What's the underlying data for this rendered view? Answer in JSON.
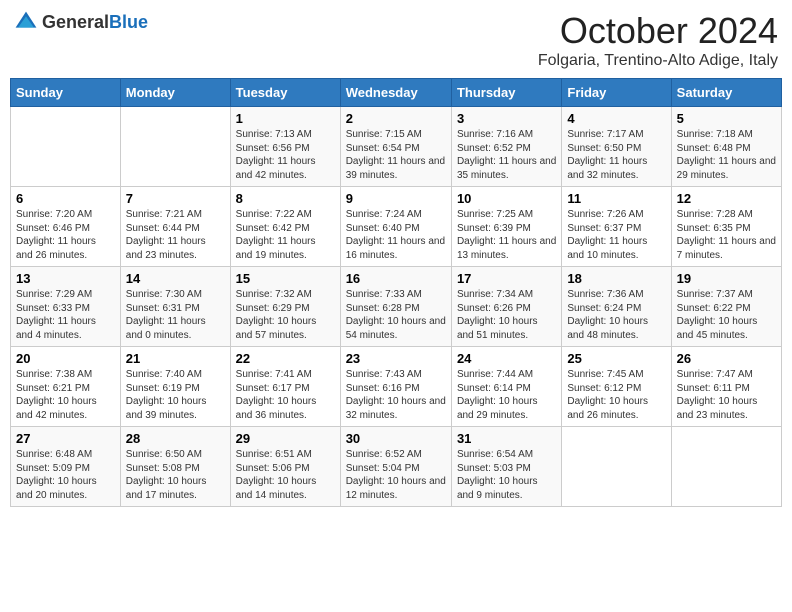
{
  "header": {
    "logo_general": "General",
    "logo_blue": "Blue",
    "month_title": "October 2024",
    "location": "Folgaria, Trentino-Alto Adige, Italy"
  },
  "days_of_week": [
    "Sunday",
    "Monday",
    "Tuesday",
    "Wednesday",
    "Thursday",
    "Friday",
    "Saturday"
  ],
  "weeks": [
    [
      {
        "day": "",
        "sunrise": "",
        "sunset": "",
        "daylight": ""
      },
      {
        "day": "",
        "sunrise": "",
        "sunset": "",
        "daylight": ""
      },
      {
        "day": "1",
        "sunrise": "Sunrise: 7:13 AM",
        "sunset": "Sunset: 6:56 PM",
        "daylight": "Daylight: 11 hours and 42 minutes."
      },
      {
        "day": "2",
        "sunrise": "Sunrise: 7:15 AM",
        "sunset": "Sunset: 6:54 PM",
        "daylight": "Daylight: 11 hours and 39 minutes."
      },
      {
        "day": "3",
        "sunrise": "Sunrise: 7:16 AM",
        "sunset": "Sunset: 6:52 PM",
        "daylight": "Daylight: 11 hours and 35 minutes."
      },
      {
        "day": "4",
        "sunrise": "Sunrise: 7:17 AM",
        "sunset": "Sunset: 6:50 PM",
        "daylight": "Daylight: 11 hours and 32 minutes."
      },
      {
        "day": "5",
        "sunrise": "Sunrise: 7:18 AM",
        "sunset": "Sunset: 6:48 PM",
        "daylight": "Daylight: 11 hours and 29 minutes."
      }
    ],
    [
      {
        "day": "6",
        "sunrise": "Sunrise: 7:20 AM",
        "sunset": "Sunset: 6:46 PM",
        "daylight": "Daylight: 11 hours and 26 minutes."
      },
      {
        "day": "7",
        "sunrise": "Sunrise: 7:21 AM",
        "sunset": "Sunset: 6:44 PM",
        "daylight": "Daylight: 11 hours and 23 minutes."
      },
      {
        "day": "8",
        "sunrise": "Sunrise: 7:22 AM",
        "sunset": "Sunset: 6:42 PM",
        "daylight": "Daylight: 11 hours and 19 minutes."
      },
      {
        "day": "9",
        "sunrise": "Sunrise: 7:24 AM",
        "sunset": "Sunset: 6:40 PM",
        "daylight": "Daylight: 11 hours and 16 minutes."
      },
      {
        "day": "10",
        "sunrise": "Sunrise: 7:25 AM",
        "sunset": "Sunset: 6:39 PM",
        "daylight": "Daylight: 11 hours and 13 minutes."
      },
      {
        "day": "11",
        "sunrise": "Sunrise: 7:26 AM",
        "sunset": "Sunset: 6:37 PM",
        "daylight": "Daylight: 11 hours and 10 minutes."
      },
      {
        "day": "12",
        "sunrise": "Sunrise: 7:28 AM",
        "sunset": "Sunset: 6:35 PM",
        "daylight": "Daylight: 11 hours and 7 minutes."
      }
    ],
    [
      {
        "day": "13",
        "sunrise": "Sunrise: 7:29 AM",
        "sunset": "Sunset: 6:33 PM",
        "daylight": "Daylight: 11 hours and 4 minutes."
      },
      {
        "day": "14",
        "sunrise": "Sunrise: 7:30 AM",
        "sunset": "Sunset: 6:31 PM",
        "daylight": "Daylight: 11 hours and 0 minutes."
      },
      {
        "day": "15",
        "sunrise": "Sunrise: 7:32 AM",
        "sunset": "Sunset: 6:29 PM",
        "daylight": "Daylight: 10 hours and 57 minutes."
      },
      {
        "day": "16",
        "sunrise": "Sunrise: 7:33 AM",
        "sunset": "Sunset: 6:28 PM",
        "daylight": "Daylight: 10 hours and 54 minutes."
      },
      {
        "day": "17",
        "sunrise": "Sunrise: 7:34 AM",
        "sunset": "Sunset: 6:26 PM",
        "daylight": "Daylight: 10 hours and 51 minutes."
      },
      {
        "day": "18",
        "sunrise": "Sunrise: 7:36 AM",
        "sunset": "Sunset: 6:24 PM",
        "daylight": "Daylight: 10 hours and 48 minutes."
      },
      {
        "day": "19",
        "sunrise": "Sunrise: 7:37 AM",
        "sunset": "Sunset: 6:22 PM",
        "daylight": "Daylight: 10 hours and 45 minutes."
      }
    ],
    [
      {
        "day": "20",
        "sunrise": "Sunrise: 7:38 AM",
        "sunset": "Sunset: 6:21 PM",
        "daylight": "Daylight: 10 hours and 42 minutes."
      },
      {
        "day": "21",
        "sunrise": "Sunrise: 7:40 AM",
        "sunset": "Sunset: 6:19 PM",
        "daylight": "Daylight: 10 hours and 39 minutes."
      },
      {
        "day": "22",
        "sunrise": "Sunrise: 7:41 AM",
        "sunset": "Sunset: 6:17 PM",
        "daylight": "Daylight: 10 hours and 36 minutes."
      },
      {
        "day": "23",
        "sunrise": "Sunrise: 7:43 AM",
        "sunset": "Sunset: 6:16 PM",
        "daylight": "Daylight: 10 hours and 32 minutes."
      },
      {
        "day": "24",
        "sunrise": "Sunrise: 7:44 AM",
        "sunset": "Sunset: 6:14 PM",
        "daylight": "Daylight: 10 hours and 29 minutes."
      },
      {
        "day": "25",
        "sunrise": "Sunrise: 7:45 AM",
        "sunset": "Sunset: 6:12 PM",
        "daylight": "Daylight: 10 hours and 26 minutes."
      },
      {
        "day": "26",
        "sunrise": "Sunrise: 7:47 AM",
        "sunset": "Sunset: 6:11 PM",
        "daylight": "Daylight: 10 hours and 23 minutes."
      }
    ],
    [
      {
        "day": "27",
        "sunrise": "Sunrise: 6:48 AM",
        "sunset": "Sunset: 5:09 PM",
        "daylight": "Daylight: 10 hours and 20 minutes."
      },
      {
        "day": "28",
        "sunrise": "Sunrise: 6:50 AM",
        "sunset": "Sunset: 5:08 PM",
        "daylight": "Daylight: 10 hours and 17 minutes."
      },
      {
        "day": "29",
        "sunrise": "Sunrise: 6:51 AM",
        "sunset": "Sunset: 5:06 PM",
        "daylight": "Daylight: 10 hours and 14 minutes."
      },
      {
        "day": "30",
        "sunrise": "Sunrise: 6:52 AM",
        "sunset": "Sunset: 5:04 PM",
        "daylight": "Daylight: 10 hours and 12 minutes."
      },
      {
        "day": "31",
        "sunrise": "Sunrise: 6:54 AM",
        "sunset": "Sunset: 5:03 PM",
        "daylight": "Daylight: 10 hours and 9 minutes."
      },
      {
        "day": "",
        "sunrise": "",
        "sunset": "",
        "daylight": ""
      },
      {
        "day": "",
        "sunrise": "",
        "sunset": "",
        "daylight": ""
      }
    ]
  ]
}
